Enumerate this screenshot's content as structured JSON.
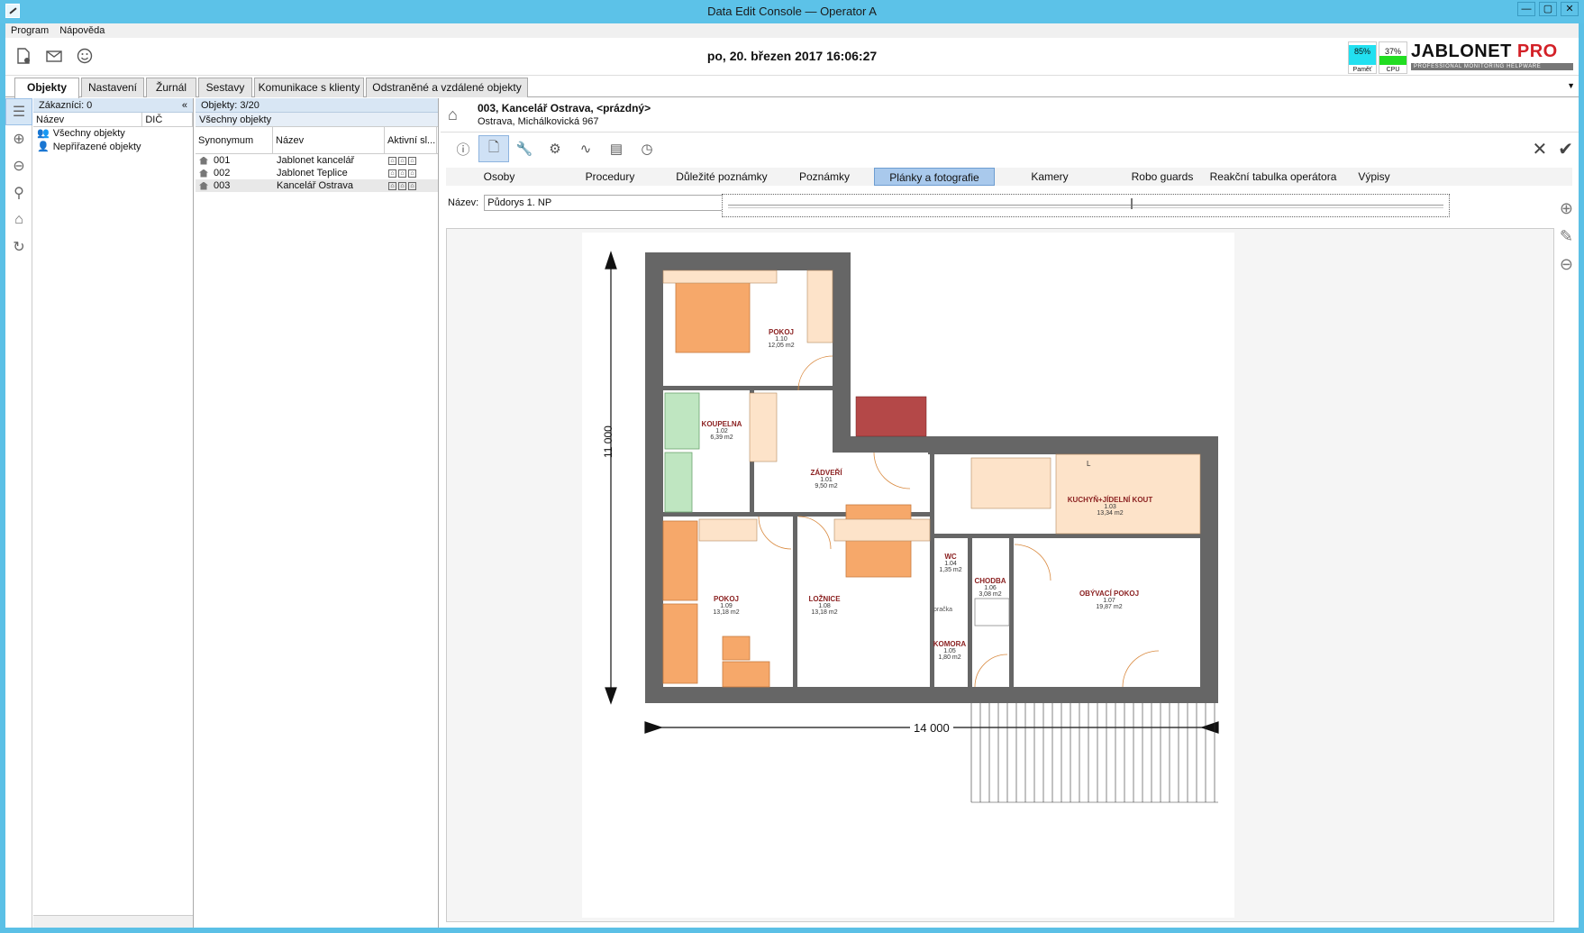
{
  "window": {
    "title": "Data Edit Console  — Operator A",
    "min": "—",
    "max": "▢",
    "close": "✕"
  },
  "menu": {
    "program": "Program",
    "help": "Nápověda"
  },
  "header": {
    "datetime": "po, 20. březen 2017 16:06:27",
    "memory": {
      "pct": "85%",
      "label": "Paměť",
      "value": 0.85,
      "color": "#22e0f0"
    },
    "cpu": {
      "pct": "37%",
      "label": "CPU",
      "value": 0.37,
      "color": "#22dd22"
    },
    "brand": {
      "name": "JABLONET",
      "suffix": "PRO",
      "tagline": "PROFESSIONAL MONITORING HELPWARE"
    }
  },
  "tabs": {
    "objekty": "Objekty",
    "nastaveni": "Nastavení",
    "zurnal": "Žurnál",
    "sestavy": "Sestavy",
    "komunikace": "Komunikace s klienty",
    "odstranene": "Odstraněné a vzdálené objekty"
  },
  "customers": {
    "header": "Zákazníci: 0",
    "collapse": "«",
    "col_name": "Název",
    "col_dic": "DIČ",
    "items": [
      "Všechny objekty",
      "Nepřiřazené objekty"
    ]
  },
  "objects": {
    "header": "Objekty: 3/20",
    "filter": "Všechny objekty",
    "col_synonym": "Synonymum",
    "col_name": "Název",
    "col_active": "Aktivní sl...",
    "rows": [
      {
        "synonym": "001",
        "name": "Jablonet kancelář"
      },
      {
        "synonym": "002",
        "name": "Jablonet Teplice"
      },
      {
        "synonym": "003",
        "name": "Kancelář Ostrava"
      }
    ]
  },
  "detail": {
    "title": "003, Kancelář Ostrava, <prázdný>",
    "address": "Ostrava, Michálkovická 967",
    "subtabs": [
      "Osoby",
      "Procedury",
      "Důležité poznámky",
      "Poznámky",
      "Plánky a fotografie",
      "Kamery",
      "Robo guards",
      "Reakční tabulka operátora",
      "Výpisy"
    ],
    "name_label": "Název:",
    "name_value": "Půdorys 1. NP"
  },
  "plan": {
    "dim_height": "11 000",
    "dim_width": "14 000",
    "rooms": [
      {
        "name": "POKOJ",
        "code": "1.10",
        "area": "12,05 m2"
      },
      {
        "name": "KOUPELNA",
        "code": "1.02",
        "area": "6,39 m2"
      },
      {
        "name": "ZÁDVEŘÍ",
        "code": "1.01",
        "area": "9,50 m2"
      },
      {
        "name": "KUCHYŇ+JÍDELNÍ KOUT",
        "code": "1.03",
        "area": "13,34 m2"
      },
      {
        "name": "WC",
        "code": "1.04",
        "area": "1,35 m2"
      },
      {
        "name": "CHODBA",
        "code": "1.06",
        "area": "3,08 m2"
      },
      {
        "name": "OBÝVACÍ POKOJ",
        "code": "1.07",
        "area": "19,87 m2"
      },
      {
        "name": "POKOJ",
        "code": "1.09",
        "area": "13,18 m2"
      },
      {
        "name": "LOŽNICE",
        "code": "1.08",
        "area": "13,18 m2"
      },
      {
        "name": "KOMORA",
        "code": "1.05",
        "area": "1,80 m2"
      }
    ],
    "pracka": "pračka",
    "kitchen_letter": "L"
  }
}
